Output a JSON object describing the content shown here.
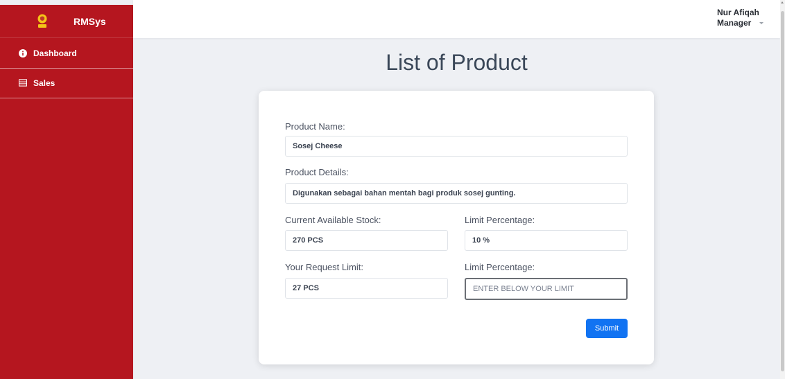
{
  "app": {
    "name": "RMSys",
    "logo_text": "RMS"
  },
  "sidebar": {
    "items": [
      {
        "label": "Dashboard",
        "icon": "info-icon"
      },
      {
        "label": "Sales",
        "icon": "table-icon"
      }
    ]
  },
  "user": {
    "name": "Nur Afiqah",
    "role": "Manager"
  },
  "page": {
    "title": "List of Product"
  },
  "form": {
    "product_name_label": "Product Name:",
    "product_name_value": "Sosej Cheese",
    "product_details_label": "Product Details:",
    "product_details_value": "Digunakan sebagai bahan mentah bagi produk sosej gunting.",
    "stock_label": "Current Available Stock:",
    "stock_value": "270 PCS",
    "limit_pct_label": "Limit Percentage:",
    "limit_pct_value": "10 %",
    "request_limit_label": "Your Request Limit:",
    "request_limit_value": "27 PCS",
    "limit_pct2_label": "Limit Percentage:",
    "limit_pct2_placeholder": "ENTER BELOW YOUR LIMIT",
    "submit_label": "Submit"
  },
  "colors": {
    "sidebar": "#b5161f",
    "accent": "#1173f2"
  }
}
